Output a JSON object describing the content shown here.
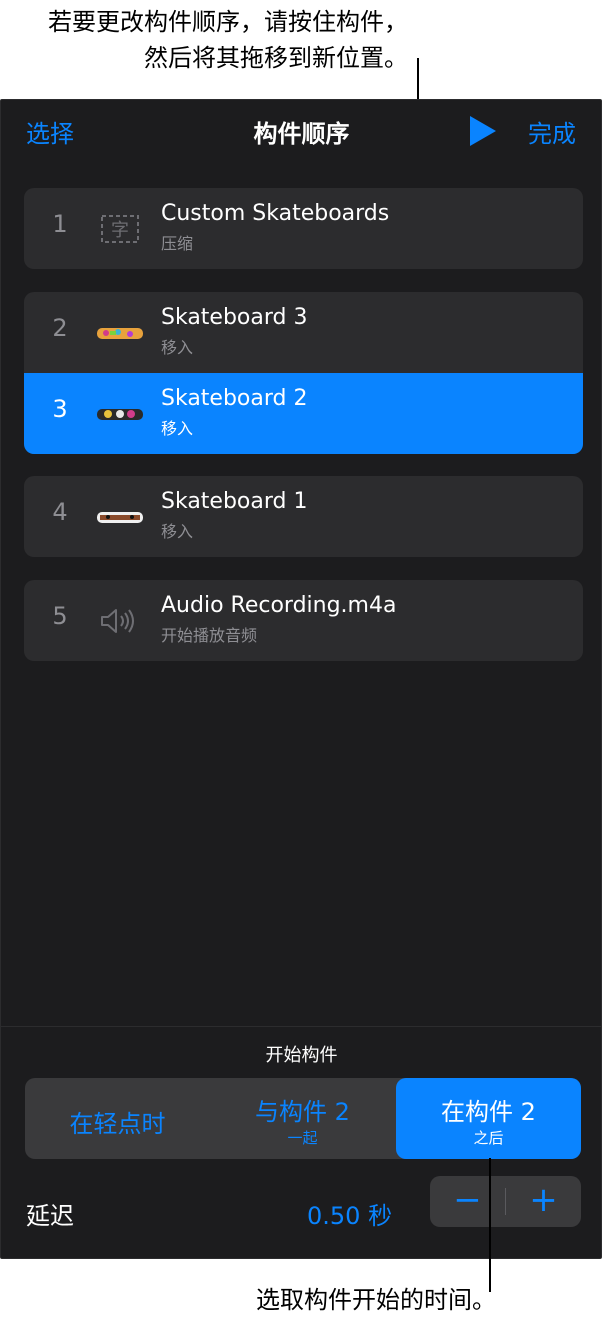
{
  "callouts": {
    "top_line1": "若要更改构件顺序，请按住构件，",
    "top_line2": "然后将其拖移到新位置。",
    "bottom": "选取构件开始的时间。"
  },
  "nav": {
    "select": "选择",
    "title": "构件顺序",
    "play_icon": "play-icon",
    "done": "完成"
  },
  "builds": [
    {
      "num": "1",
      "title": "Custom Skateboards",
      "sub": "压缩",
      "icon": "text-box-icon"
    },
    {
      "num": "2",
      "title": "Skateboard 3",
      "sub": "移入",
      "icon": "skateboard-thumbnail"
    },
    {
      "num": "3",
      "title": "Skateboard 2",
      "sub": "移入",
      "icon": "skateboard-thumbnail",
      "selected": true
    },
    {
      "num": "4",
      "title": "Skateboard 1",
      "sub": "移入",
      "icon": "skateboard-thumbnail"
    },
    {
      "num": "5",
      "title": "Audio Recording.m4a",
      "sub": "开始播放音频",
      "icon": "speaker-icon"
    }
  ],
  "start": {
    "label": "开始构件",
    "options": [
      {
        "main": "在轻点时",
        "minor": ""
      },
      {
        "main": "与构件 2",
        "minor": "一起"
      },
      {
        "main": "在构件 2",
        "minor": "之后",
        "selected": true
      }
    ]
  },
  "delay": {
    "label": "延迟",
    "value": "0.50 秒",
    "minus": "−",
    "plus": "+"
  },
  "colors": {
    "accent": "#0a84ff",
    "panel": "#1c1c1e",
    "card": "#2c2c2e"
  }
}
